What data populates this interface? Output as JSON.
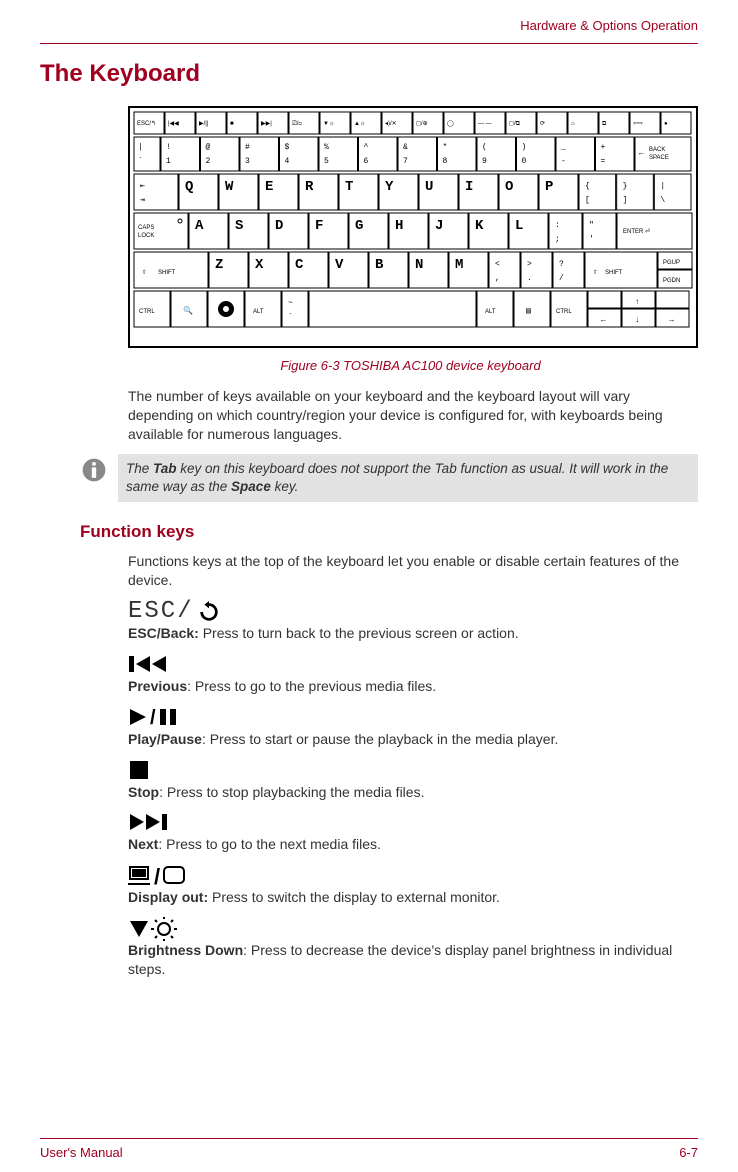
{
  "header": {
    "section": "Hardware & Options Operation"
  },
  "title": "The Keyboard",
  "figure_caption": "Figure 6-3 TOSHIBA AC100 device keyboard",
  "intro": "The number of keys available on your keyboard and the keyboard layout will vary depending on which country/region your device is configured for, with keyboards being available for numerous languages.",
  "note_part1": "The ",
  "note_bold1": "Tab",
  "note_part2": " key on this keyboard does not support the Tab function as usual. It will work in the same way as the ",
  "note_bold2": "Space",
  "note_part3": " key.",
  "subhead": "Function keys",
  "subintro": "Functions keys at the top of the keyboard let you enable or disable certain features of the device.",
  "fn": {
    "esc": {
      "label": "ESC/Back:",
      "desc": " Press to turn back to the previous screen or action."
    },
    "prev": {
      "label": "Previous",
      "desc": ": Press to go to the previous media files."
    },
    "play": {
      "label": "Play/Pause",
      "desc": ": Press to start or pause the playback in the media player."
    },
    "stop": {
      "label": "Stop",
      "desc": ": Press to stop playbacking the media files."
    },
    "next": {
      "label": "Next",
      "desc": ": Press to go to the next media files."
    },
    "disp": {
      "label": "Display out:",
      "desc": " Press to switch the display to external monitor."
    },
    "bdown": {
      "label": "Brightness Down",
      "desc": ": Press to decrease the device's display panel brightness in individual steps."
    }
  },
  "footer": {
    "left": "User's Manual",
    "right": "6-7"
  },
  "keyboard": {
    "row_fn": [
      "ESC/↰",
      "|◀◀",
      "▶/||",
      "■",
      "▶▶|",
      "⎚/◻",
      "▼☼",
      "▲☼",
      "◂)/✕",
      "◻/⊕",
      "◯",
      "— —",
      "◻/⧉",
      "⟳",
      "⌂",
      "⧉",
      "⇦⇨",
      "●"
    ],
    "row_num_top": [
      "!",
      "@",
      "#",
      "$",
      "%",
      "^",
      "&",
      "*",
      "(",
      ")",
      "_",
      "+"
    ],
    "row_num_bot": [
      "1",
      "2",
      "3",
      "4",
      "5",
      "6",
      "7",
      "8",
      "9",
      "0",
      "-",
      "="
    ],
    "row_num_lead_top": "|",
    "row_num_lead_bot": "`",
    "backspace": "BACK SPACE",
    "row_q": [
      "Q",
      "W",
      "E",
      "R",
      "T",
      "Y",
      "U",
      "I",
      "O",
      "P"
    ],
    "row_q_sym_top": [
      "{",
      "}",
      "|"
    ],
    "row_q_sym_bot": [
      "[",
      "]",
      "\\"
    ],
    "tab": "⇥",
    "caps": "CAPS LOCK",
    "row_a": [
      "A",
      "S",
      "D",
      "F",
      "G",
      "H",
      "J",
      "K",
      "L"
    ],
    "row_a_sym_top": [
      ":",
      "\""
    ],
    "row_a_sym_bot": [
      ";",
      "'"
    ],
    "enter": "ENTER  ⏎",
    "shift": "SHIFT",
    "row_z": [
      "Z",
      "X",
      "C",
      "V",
      "B",
      "N",
      "M"
    ],
    "row_z_sym_top": [
      "<",
      ">",
      "?"
    ],
    "row_z_sym_bot": [
      ",",
      ".",
      "/"
    ],
    "pgup": "PGUP",
    "pgdn": "PGDN",
    "ctrl": "CTRL",
    "alt": "ALT",
    "tilde_top": "~",
    "tilde_bot": "`",
    "arrows": {
      "up": "↑",
      "down": "↓",
      "left": "←",
      "right": "→"
    }
  }
}
